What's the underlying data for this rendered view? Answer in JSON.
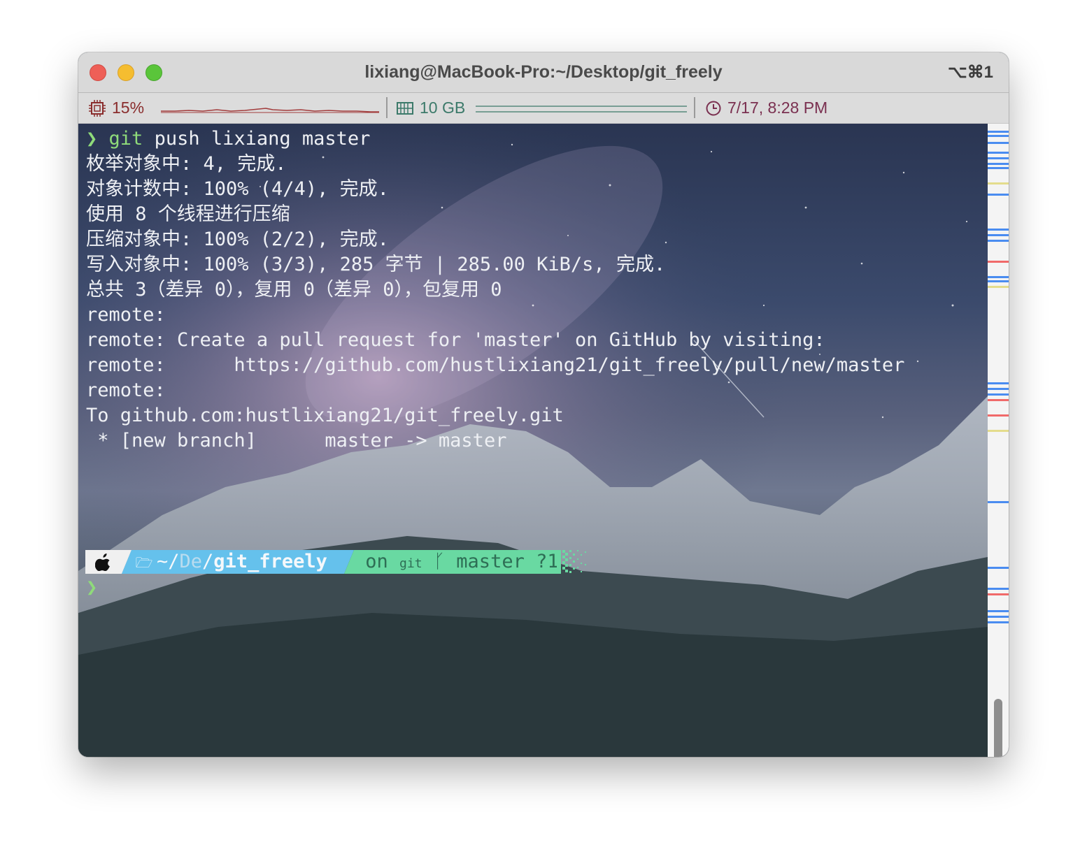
{
  "window": {
    "title": "lixiang@MacBook-Pro:~/Desktop/git_freely",
    "shortcut": "⌥⌘1"
  },
  "status": {
    "cpu": "15%",
    "memory": "10 GB",
    "clock": "7/17, 8:28 PM",
    "colors": {
      "cpu": "#8a2d2d",
      "memory": "#3c7a6a",
      "clock": "#7a3050"
    }
  },
  "terminal": {
    "command_prompt_glyph": "❯",
    "command_name": "git",
    "command_args": " push lixiang master",
    "output": [
      "枚举对象中: 4, 完成.",
      "对象计数中: 100% (4/4), 完成.",
      "使用 8 个线程进行压缩",
      "压缩对象中: 100% (2/2), 完成.",
      "写入对象中: 100% (3/3), 285 字节 | 285.00 KiB/s, 完成.",
      "总共 3（差异 0），复用 0（差异 0），包复用 0",
      "remote:",
      "remote: Create a pull request for 'master' on GitHub by visiting:",
      "remote:      https://github.com/hustlixiang21/git_freely/pull/new/master",
      "remote:",
      "To github.com:hustlixiang21/git_freely.git",
      " * [new branch]      master -> master"
    ],
    "prompt": {
      "apple_glyph": "",
      "folder_glyph": "🗁",
      "path_home": "~/",
      "path_dim": "De",
      "path_sep": "/",
      "path_dir": "git_freely",
      "on_label": "on",
      "git_label": "git",
      "branch_glyph": "ᚴ",
      "branch": "master",
      "status": "?1"
    },
    "cursor_glyph": "❯",
    "colors": {
      "accent_green": "#8fdb7a",
      "path_blue": "#65c1ec",
      "git_green": "#69d9a2"
    }
  },
  "scrollbar": {
    "mark_colors": {
      "blue": "#4a8cf0",
      "red": "#f06a6a",
      "yellow": "#e4dc8c"
    }
  }
}
